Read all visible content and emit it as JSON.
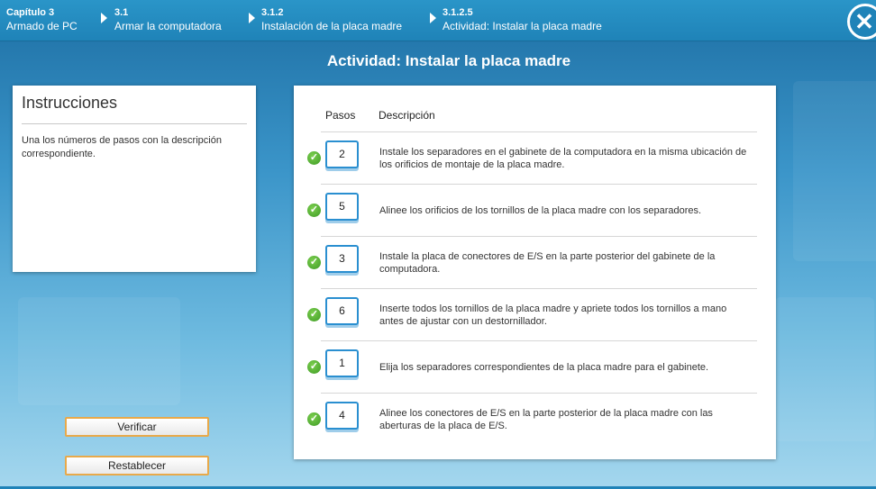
{
  "breadcrumbs": [
    {
      "num": "Capítulo 3",
      "text": "Armado de PC"
    },
    {
      "num": "3.1",
      "text": "Armar la computadora"
    },
    {
      "num": "3.1.2",
      "text": "Instalación de la placa madre"
    },
    {
      "num": "3.1.2.5",
      "text": "Actividad: Instalar la placa madre"
    }
  ],
  "close_icon": "close-icon",
  "page_title": "Actividad: Instalar la placa madre",
  "instructions": {
    "title": "Instrucciones",
    "body": "Una los números de pasos con la descripción correspondiente."
  },
  "buttons": {
    "verify": "Verificar",
    "reset": "Restablecer"
  },
  "steps": {
    "header_steps": "Pasos",
    "header_desc": "Descripción",
    "rows": [
      {
        "step": "2",
        "desc": "Instale los separadores en el gabinete de la computadora en la misma ubicación de los orificios de montaje de la placa madre.",
        "correct": true
      },
      {
        "step": "5",
        "desc": "Alinee los orificios de los tornillos de la placa madre con los separadores.",
        "correct": true
      },
      {
        "step": "3",
        "desc": "Instale la placa de conectores de E/S en la parte posterior del gabinete de la computadora.",
        "correct": true
      },
      {
        "step": "6",
        "desc": "Inserte todos los tornillos de la placa madre y apriete todos los tornillos a mano antes de ajustar con un destornillador.",
        "correct": true
      },
      {
        "step": "1",
        "desc": "Elija los separadores correspondientes de la placa madre para el gabinete.",
        "correct": true
      },
      {
        "step": "4",
        "desc": "Alinee los conectores de E/S en la parte posterior de la placa madre con las aberturas de la placa de E/S.",
        "correct": true
      }
    ]
  },
  "colors": {
    "accent": "#1f83b8",
    "button_border": "#e8a94a",
    "check": "#3d9a24"
  }
}
